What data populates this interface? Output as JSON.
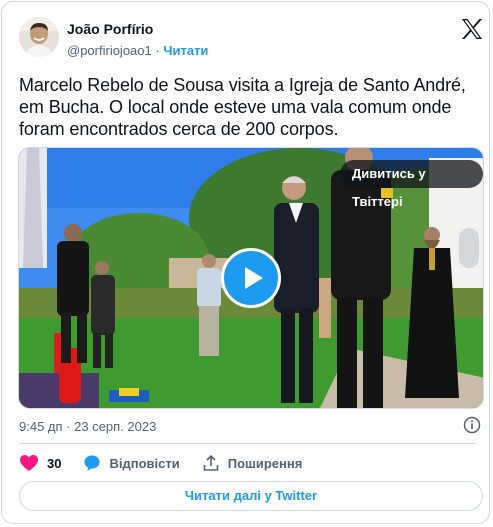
{
  "author": {
    "name": "João Porfírio",
    "handle": "@porfiriojoao1",
    "separator": "·",
    "follow_label": "Читати"
  },
  "tweet": {
    "text": "Marcelo Rebelo de Sousa visita a Igreja de Santo André, em Bucha. O local onde esteve uma vala comum onde foram encontrados cerca de 200 corpos.",
    "timestamp": "9:45 дп · 23 серп. 2023"
  },
  "media": {
    "watch_label": "Дивитись у Твіттері",
    "play_icon": "play-icon"
  },
  "actions": {
    "likes_count": "30",
    "reply_label": "Відповісти",
    "share_label": "Поширення"
  },
  "footer": {
    "read_more_label": "Читати далі у Twitter"
  },
  "colors": {
    "accent": "#1d9bf0",
    "like": "#f91880",
    "text": "#0f1419",
    "muted": "#536471",
    "border": "#cfd9de"
  }
}
